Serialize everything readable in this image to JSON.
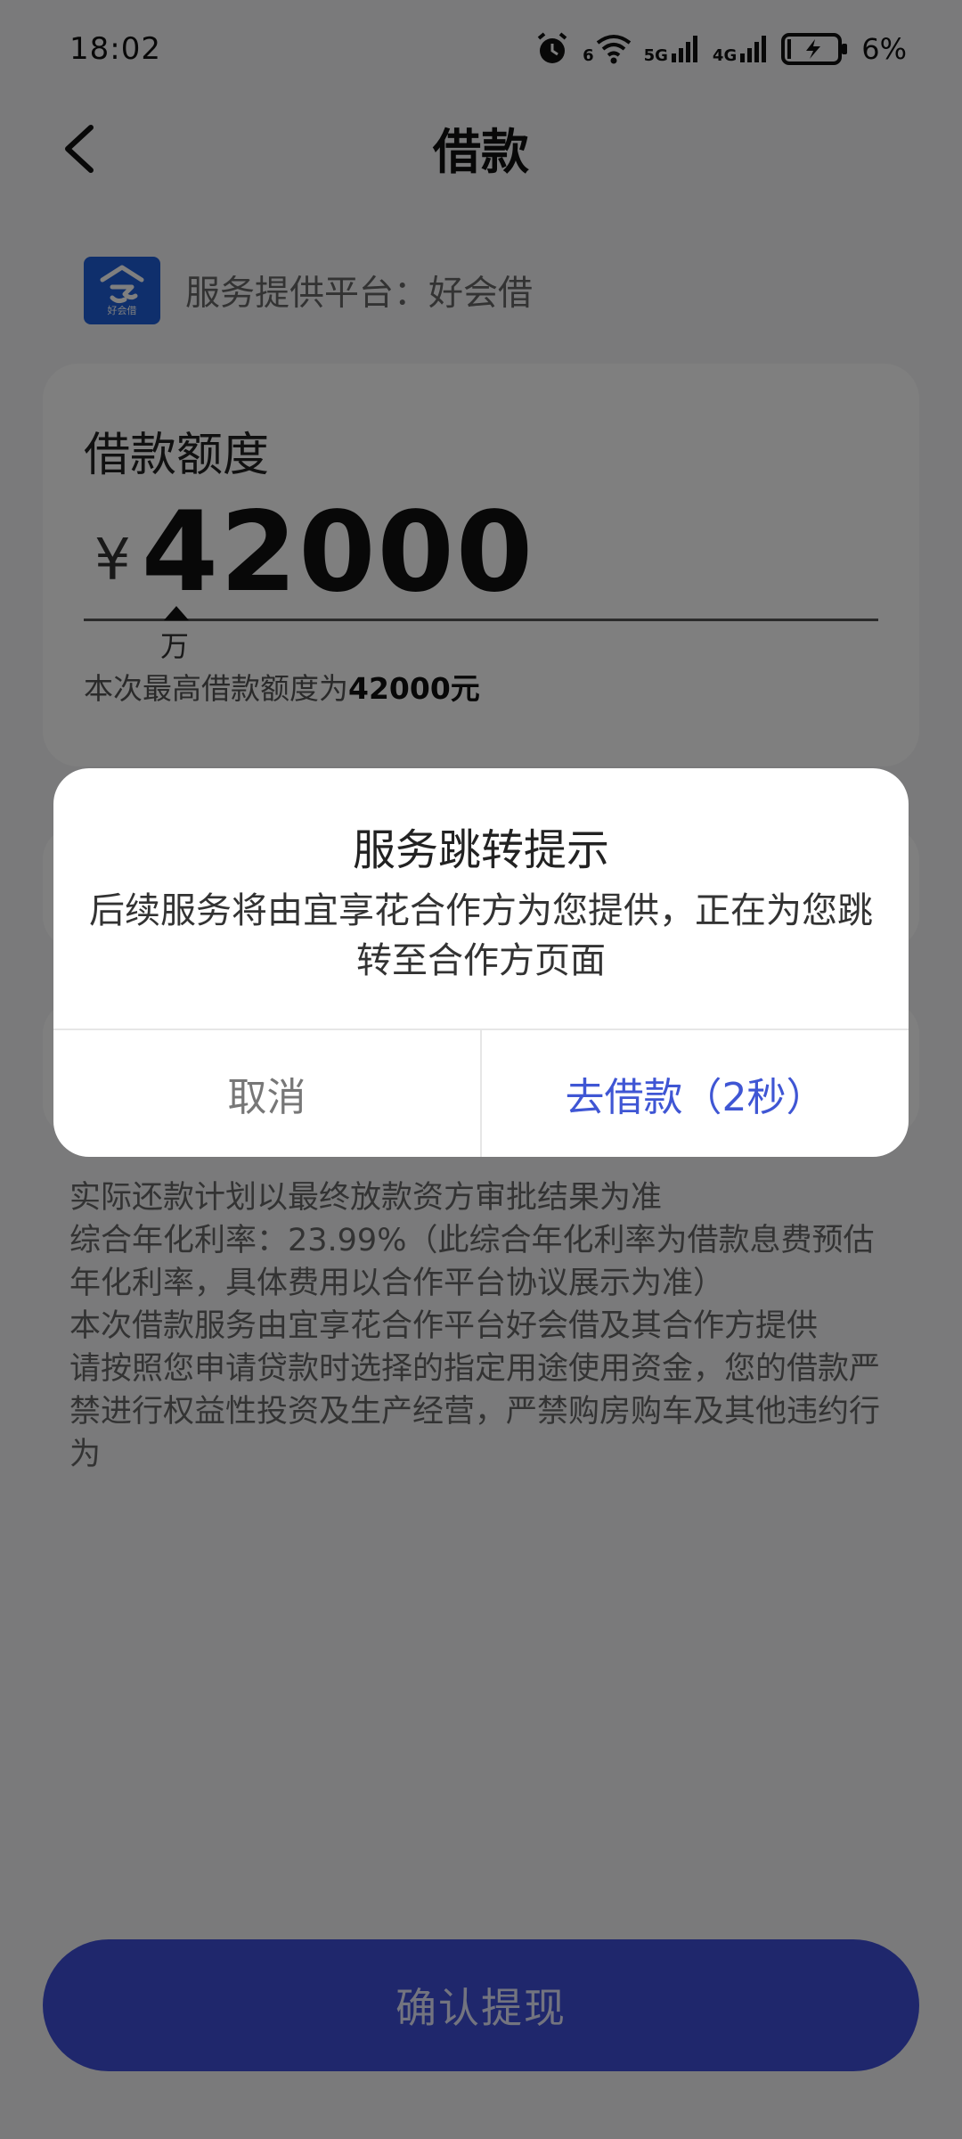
{
  "status_bar": {
    "time": "18:02",
    "wifi_label": "6",
    "net1": "5G",
    "net2": "4G",
    "battery": "6%"
  },
  "header": {
    "title": "借款"
  },
  "provider": {
    "logo_text": "好会借",
    "label": "服务提供平台：好会借"
  },
  "amount_card": {
    "title": "借款额度",
    "currency": "¥",
    "amount": "42000",
    "unit": "万",
    "max_note_prefix": "本次最高借款额度为",
    "max_note_value": "42000元"
  },
  "disclaimer": {
    "lines": [
      "实际还款计划以最终放款资方审批结果为准",
      "综合年化利率：23.99%（此综合年化利率为借款息费预估年化利率，具体费用以合作平台协议展示为准）",
      "本次借款服务由宜享花合作平台好会借及其合作方提供",
      "请按照您申请贷款时选择的指定用途使用资金，您的借款严禁进行权益性投资及生产经营，严禁购房购车及其他违约行为"
    ]
  },
  "confirm_button": {
    "label": "确认提现"
  },
  "dialog": {
    "title": "服务跳转提示",
    "message": "后续服务将由宜享花合作方为您提供，正在为您跳转至合作方页面",
    "cancel_label": "取消",
    "go_label": "去借款（2秒）"
  },
  "colors": {
    "brand_blue": "#3f4ed8",
    "link_blue": "#3f56d4",
    "logo_blue": "#1e5ed8"
  }
}
